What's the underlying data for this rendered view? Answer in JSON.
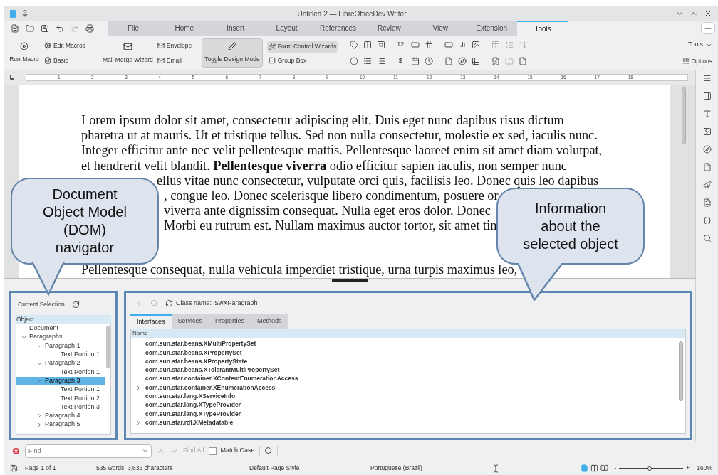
{
  "window": {
    "title": "Untitled 2 — LibreOfficeDev Writer"
  },
  "menu_tabs": [
    {
      "label": "File",
      "selected": false
    },
    {
      "label": "Home",
      "selected": false
    },
    {
      "label": "Insert",
      "selected": false
    },
    {
      "label": "Layout",
      "selected": false
    },
    {
      "label": "References",
      "selected": false
    },
    {
      "label": "Review",
      "selected": false
    },
    {
      "label": "View",
      "selected": false
    },
    {
      "label": "Extension",
      "selected": false
    },
    {
      "label": "Tools",
      "selected": true
    }
  ],
  "ribbon": {
    "run_macro": "Run Macro",
    "edit_macros": "Edit Macros",
    "basic": "Basic",
    "mail_merge": "Mail Merge Wizard",
    "envelope": "Envelope",
    "email": "Email",
    "design_mode": {
      "label": "Toggle Design Mode",
      "on": true
    },
    "wizards": {
      "label": "Form Control Wizards",
      "on": true
    },
    "group_box": "Group Box",
    "numeric_field": "12",
    "currency_field": "$",
    "tools_menu": "Tools",
    "options": "Options"
  },
  "ruler": {
    "numbers": [
      "1",
      "2",
      "3",
      "4",
      "5",
      "6",
      "7",
      "8",
      "9",
      "10",
      "11",
      "12",
      "13",
      "14",
      "15",
      "16",
      "17",
      "18"
    ]
  },
  "document": {
    "paragraphs": [
      {
        "lines": [
          {
            "kind": "full",
            "text": "Lorem ipsum dolor sit amet, consectetur adipiscing elit. Duis eget nunc dapibus risus dictum"
          },
          {
            "kind": "full",
            "text": "pharetra ut at mauris. Ut et tristique tellus. Sed non nulla consectetur, molestie ex sed, iaculis nunc."
          },
          {
            "kind": "full",
            "text": "Integer efficitur ante nec velit pellentesque mattis. Pellentesque laoreet enim sit amet diam volutpat,"
          },
          {
            "kind": "full",
            "text": "et hendrerit velit blandit. **Pellentesque viverra** odio efficitur sapien iaculis, non semper nunc"
          },
          {
            "kind": "cut_short",
            "text": "ellus vitae nunc consectetur, vulputate orci quis, facilisis leo. Donec quis leo dapibus"
          },
          {
            "kind": "cut",
            "text": ", congue leo. Donec scelerisque libero condimentum, posuere or"
          },
          {
            "kind": "cut",
            "text": "viverra ante dignissim consequat. Nulla eget eros dolor. Donec"
          },
          {
            "kind": "cut",
            "text": "Morbi eu rutrum est. Nullam maximus auctor tortor, sit amet tin"
          }
        ]
      },
      {
        "lines": [
          {
            "kind": "full",
            "text": "Pellentesque consequat, nulla vehicula imperdiet tristique, urna turpis maximus leo,"
          }
        ]
      }
    ]
  },
  "callouts": [
    {
      "text": "Document\nObject Model\n(DOM)\nnavigator"
    },
    {
      "text": "Information\nabout the\nselected object"
    }
  ],
  "dom_navigator": {
    "current_selection": "Current Selection",
    "column": "Object",
    "tree": [
      {
        "label": "Document",
        "selected": false
      },
      {
        "label": "Paragraphs",
        "expanded": true,
        "selected": false,
        "children": [
          {
            "label": "Paragraph 1",
            "expanded": true,
            "selected": false,
            "children": [
              {
                "label": "Text Portion 1",
                "selected": false
              }
            ]
          },
          {
            "label": "Paragraph 2",
            "expanded": true,
            "selected": false,
            "children": [
              {
                "label": "Text Portion 1",
                "selected": false
              }
            ]
          },
          {
            "label": "Paragraph 3",
            "expanded": true,
            "selected": true,
            "children": [
              {
                "label": "Text Portion 1",
                "selected": false
              },
              {
                "label": "Text Portion 2",
                "selected": false
              },
              {
                "label": "Text Portion 3",
                "selected": false
              }
            ]
          },
          {
            "label": "Paragraph 4",
            "expanded": false,
            "selected": false
          },
          {
            "label": "Paragraph 5",
            "expanded": false,
            "selected": false
          }
        ]
      }
    ]
  },
  "inspector": {
    "class_label": "Class name:",
    "class_name": "SwXParagraph",
    "tabs": [
      {
        "label": "Interfaces",
        "selected": true
      },
      {
        "label": "Services",
        "selected": false
      },
      {
        "label": "Properties",
        "selected": false
      },
      {
        "label": "Methods",
        "selected": false
      }
    ],
    "column": "Name",
    "interfaces": [
      {
        "name": "com.sun.star.beans.XMultiPropertySet"
      },
      {
        "name": "com.sun.star.beans.XPropertySet"
      },
      {
        "name": "com.sun.star.beans.XPropertyState"
      },
      {
        "name": "com.sun.star.beans.XTolerantMultiPropertySet"
      },
      {
        "name": "com.sun.star.container.XContentEnumerationAccess"
      },
      {
        "name": "com.sun.star.container.XEnumerationAccess",
        "expandable": true
      },
      {
        "name": "com.sun.star.lang.XServiceInfo"
      },
      {
        "name": "com.sun.star.lang.XTypeProvider"
      },
      {
        "name": "com.sun.star.lang.XTypeProvider"
      },
      {
        "name": "com.sun.star.rdf.XMetadatable",
        "expandable": true
      }
    ]
  },
  "find_bar": {
    "placeholder": "Find",
    "find_all": {
      "label": "Find All",
      "disabled": true
    },
    "match_case": {
      "label": "Match Case",
      "checked": false
    }
  },
  "status_bar": {
    "page": "Page 1 of 1",
    "words": "535 words, 3,636 characters",
    "page_style": "Default Page Style",
    "language": "Portuguese (Brazil)",
    "views": [
      {
        "selected": true
      },
      {
        "selected": false
      },
      {
        "selected": false
      }
    ],
    "zoom_minus": "-",
    "zoom_plus": "+",
    "zoom": {
      "level": 0.48
    },
    "zoom_percent": "160%"
  }
}
